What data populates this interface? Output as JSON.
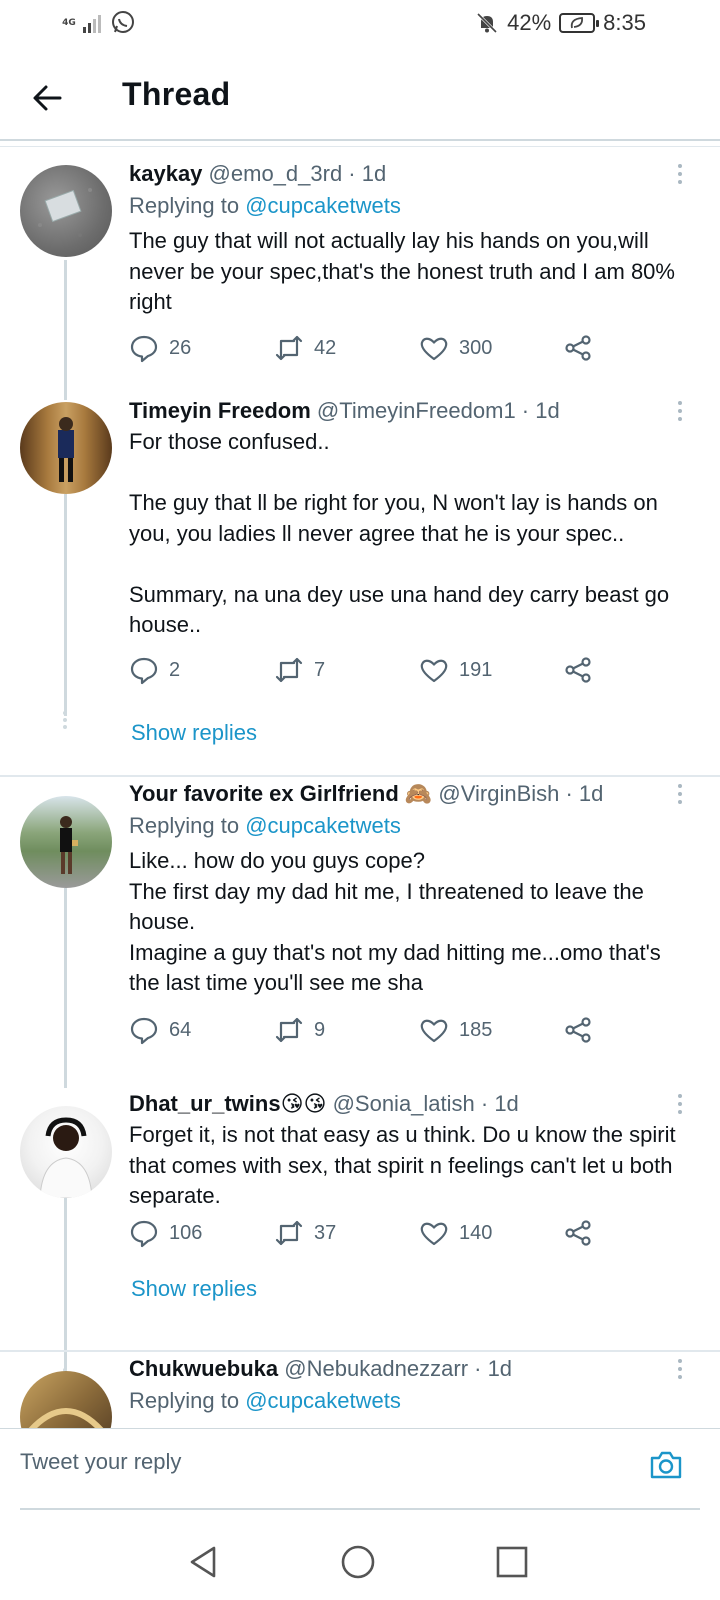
{
  "status_bar": {
    "network": "4G",
    "battery": "42%",
    "time": "8:35"
  },
  "header": {
    "title": "Thread"
  },
  "tweets": [
    {
      "name": "kaykay",
      "handle": "@emo_d_3rd · 1d",
      "replying_prefix": "Replying to",
      "replying_to": "@cupcaketwets",
      "text": "The guy that will not actually lay his hands on you,will never be your spec,that's the honest truth and I am 80% right",
      "replies": "26",
      "retweets": "42",
      "likes": "300"
    },
    {
      "name": "Timeyin Freedom",
      "handle": "@TimeyinFreedom1 · 1d",
      "text": "For those confused..\n\nThe guy that ll be right for you, N won't lay is hands on you, you ladies ll never agree that he is your spec..\n\nSummary, na una dey use una hand dey carry beast go house..",
      "replies": "2",
      "retweets": "7",
      "likes": "191",
      "show_replies": "Show replies"
    },
    {
      "name": "Your favorite ex Girlfriend 🙈",
      "handle": "@VirginBish · 1d",
      "replying_prefix": "Replying to",
      "replying_to": "@cupcaketwets",
      "text": "Like... how do you guys cope?\nThe first day my dad hit me, I threatened to leave the house.\nImagine a guy that's not my dad hitting me...omo that's the last time you'll see me sha",
      "replies": "64",
      "retweets": "9",
      "likes": "185"
    },
    {
      "name": "Dhat_ur_twins😘😘",
      "handle": "@Sonia_latish · 1d",
      "text": "Forget it, is not that easy as u think. Do u know the spirit that comes with sex, that spirit n feelings can't let u both separate.",
      "replies": "106",
      "retweets": "37",
      "likes": "140",
      "show_replies": "Show replies"
    },
    {
      "name": "Chukwuebuka",
      "handle": "@Nebukadnezzarr · 1d",
      "replying_prefix": "Replying to",
      "replying_to": "@cupcaketwets"
    }
  ],
  "composer": {
    "placeholder": "Tweet your reply"
  },
  "colors": {
    "accent": "#1b95c9",
    "text": "#0f1419",
    "muted": "#536471",
    "divider": "#cfd9de"
  }
}
